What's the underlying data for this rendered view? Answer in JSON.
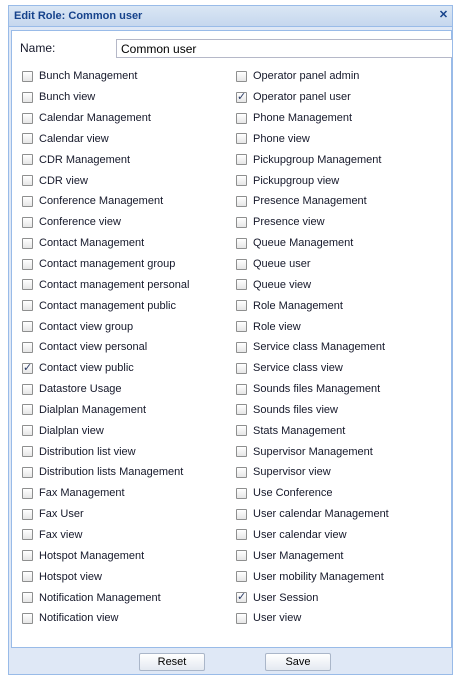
{
  "dialog": {
    "title": "Edit Role: Common user",
    "close_icon": "close-icon"
  },
  "name": {
    "label": "Name:",
    "value": "Common user"
  },
  "permissions_left": [
    {
      "label": "Bunch Management",
      "checked": false
    },
    {
      "label": "Bunch view",
      "checked": false
    },
    {
      "label": "Calendar Management",
      "checked": false
    },
    {
      "label": "Calendar view",
      "checked": false
    },
    {
      "label": "CDR Management",
      "checked": false
    },
    {
      "label": "CDR view",
      "checked": false
    },
    {
      "label": "Conference Management",
      "checked": false
    },
    {
      "label": "Conference view",
      "checked": false
    },
    {
      "label": "Contact Management",
      "checked": false
    },
    {
      "label": "Contact management group",
      "checked": false
    },
    {
      "label": "Contact management personal",
      "checked": false
    },
    {
      "label": "Contact management public",
      "checked": false
    },
    {
      "label": "Contact view group",
      "checked": false
    },
    {
      "label": "Contact view personal",
      "checked": false
    },
    {
      "label": "Contact view public",
      "checked": true
    },
    {
      "label": "Datastore Usage",
      "checked": false
    },
    {
      "label": "Dialplan Management",
      "checked": false
    },
    {
      "label": "Dialplan view",
      "checked": false
    },
    {
      "label": "Distribution list view",
      "checked": false
    },
    {
      "label": "Distribution lists Management",
      "checked": false
    },
    {
      "label": "Fax Management",
      "checked": false
    },
    {
      "label": "Fax User",
      "checked": false
    },
    {
      "label": "Fax view",
      "checked": false
    },
    {
      "label": "Hotspot Management",
      "checked": false
    },
    {
      "label": "Hotspot view",
      "checked": false
    },
    {
      "label": "Notification Management",
      "checked": false
    },
    {
      "label": "Notification view",
      "checked": false
    }
  ],
  "permissions_right": [
    {
      "label": "Operator panel admin",
      "checked": false
    },
    {
      "label": "Operator panel user",
      "checked": true
    },
    {
      "label": "Phone Management",
      "checked": false
    },
    {
      "label": "Phone view",
      "checked": false
    },
    {
      "label": "Pickupgroup Management",
      "checked": false
    },
    {
      "label": "Pickupgroup view",
      "checked": false
    },
    {
      "label": "Presence Management",
      "checked": false
    },
    {
      "label": "Presence view",
      "checked": false
    },
    {
      "label": "Queue Management",
      "checked": false
    },
    {
      "label": "Queue user",
      "checked": false
    },
    {
      "label": "Queue view",
      "checked": false
    },
    {
      "label": "Role Management",
      "checked": false
    },
    {
      "label": "Role view",
      "checked": false
    },
    {
      "label": "Service class Management",
      "checked": false
    },
    {
      "label": "Service class view",
      "checked": false
    },
    {
      "label": "Sounds files Management",
      "checked": false
    },
    {
      "label": "Sounds files view",
      "checked": false
    },
    {
      "label": "Stats Management",
      "checked": false
    },
    {
      "label": "Supervisor Management",
      "checked": false
    },
    {
      "label": "Supervisor view",
      "checked": false
    },
    {
      "label": "Use Conference",
      "checked": false
    },
    {
      "label": "User calendar Management",
      "checked": false
    },
    {
      "label": "User calendar view",
      "checked": false
    },
    {
      "label": "User Management",
      "checked": false
    },
    {
      "label": "User mobility Management",
      "checked": false
    },
    {
      "label": "User Session",
      "checked": true
    },
    {
      "label": "User view",
      "checked": false
    }
  ],
  "buttons": {
    "reset_label": "Reset",
    "save_label": "Save"
  },
  "colors": {
    "title_text": "#15428b",
    "border": "#99bbe8",
    "dialog_bg": "#dfe8f6"
  }
}
